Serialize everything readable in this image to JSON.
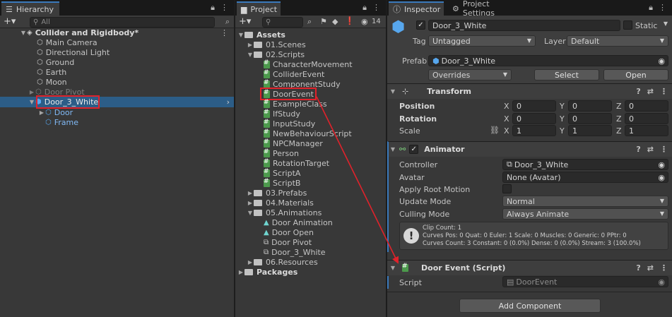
{
  "hierarchy": {
    "tab_label": "Hierarchy",
    "search_placeholder": "All",
    "scene_name": "Collider and Rigidbody*",
    "items": [
      {
        "label": "Main Camera"
      },
      {
        "label": "Directional Light"
      },
      {
        "label": "Ground"
      },
      {
        "label": "Earth"
      },
      {
        "label": "Moon"
      },
      {
        "label": "Door Pivot"
      },
      {
        "label": "Door_3_White"
      },
      {
        "label": "Door"
      },
      {
        "label": "Frame"
      }
    ]
  },
  "project": {
    "tab_label": "Project",
    "hidden_count": "14",
    "root": "Assets",
    "folders": [
      {
        "label": "01.Scenes"
      },
      {
        "label": "02.Scripts"
      },
      {
        "label": "03.Prefabs"
      },
      {
        "label": "04.Materials"
      },
      {
        "label": "05.Animations"
      },
      {
        "label": "06.Resources"
      }
    ],
    "scripts": [
      {
        "label": "CharacterMovement"
      },
      {
        "label": "ColliderEvent"
      },
      {
        "label": "ComponentStudy"
      },
      {
        "label": "DoorEvent"
      },
      {
        "label": "ExampleClass"
      },
      {
        "label": "IfStudy"
      },
      {
        "label": "InputStudy"
      },
      {
        "label": "NewBehaviourScript"
      },
      {
        "label": "NPCManager"
      },
      {
        "label": "Person"
      },
      {
        "label": "RotationTarget"
      },
      {
        "label": "ScriptA"
      },
      {
        "label": "ScriptB"
      }
    ],
    "animations": [
      {
        "label": "Door Animation"
      },
      {
        "label": "Door Open"
      },
      {
        "label": "Door Pivot"
      },
      {
        "label": "Door_3_White"
      }
    ],
    "packages": "Packages"
  },
  "inspector": {
    "tab_label": "Inspector",
    "tab2_label": "Project Settings",
    "object_name": "Door_3_White",
    "static_label": "Static",
    "tag_label": "Tag",
    "tag_value": "Untagged",
    "layer_label": "Layer",
    "layer_value": "Default",
    "prefab_label": "Prefab",
    "prefab_value": "Door_3_White",
    "overrides_label": "Overrides",
    "select_label": "Select",
    "open_label": "Open",
    "transform": {
      "title": "Transform",
      "position_label": "Position",
      "rotation_label": "Rotation",
      "scale_label": "Scale",
      "position": {
        "x": "0",
        "y": "0",
        "z": "0"
      },
      "rotation": {
        "x": "0",
        "y": "0",
        "z": "0"
      },
      "scale": {
        "x": "1",
        "y": "1",
        "z": "1"
      },
      "axis_x": "X",
      "axis_y": "Y",
      "axis_z": "Z"
    },
    "animator": {
      "title": "Animator",
      "controller_label": "Controller",
      "controller_value": "Door_3_White",
      "avatar_label": "Avatar",
      "avatar_value": "None (Avatar)",
      "root_motion_label": "Apply Root Motion",
      "update_mode_label": "Update Mode",
      "update_mode_value": "Normal",
      "culling_mode_label": "Culling Mode",
      "culling_mode_value": "Always Animate",
      "info_line1": "Clip Count: 1",
      "info_line2": "Curves Pos: 0 Quat: 0 Euler: 1 Scale: 0 Muscles: 0 Generic: 0 PPtr: 0",
      "info_line3": "Curves Count: 3 Constant: 0 (0.0%) Dense: 0 (0.0%) Stream: 3 (100.0%)"
    },
    "door_event": {
      "title": "Door Event (Script)",
      "script_label": "Script",
      "script_value": "DoorEvent"
    },
    "add_component_label": "Add Component"
  },
  "colors": {
    "highlight_red": "#e0222b",
    "selection_blue": "#2c5d87",
    "tab_accent": "#3a79bb"
  }
}
